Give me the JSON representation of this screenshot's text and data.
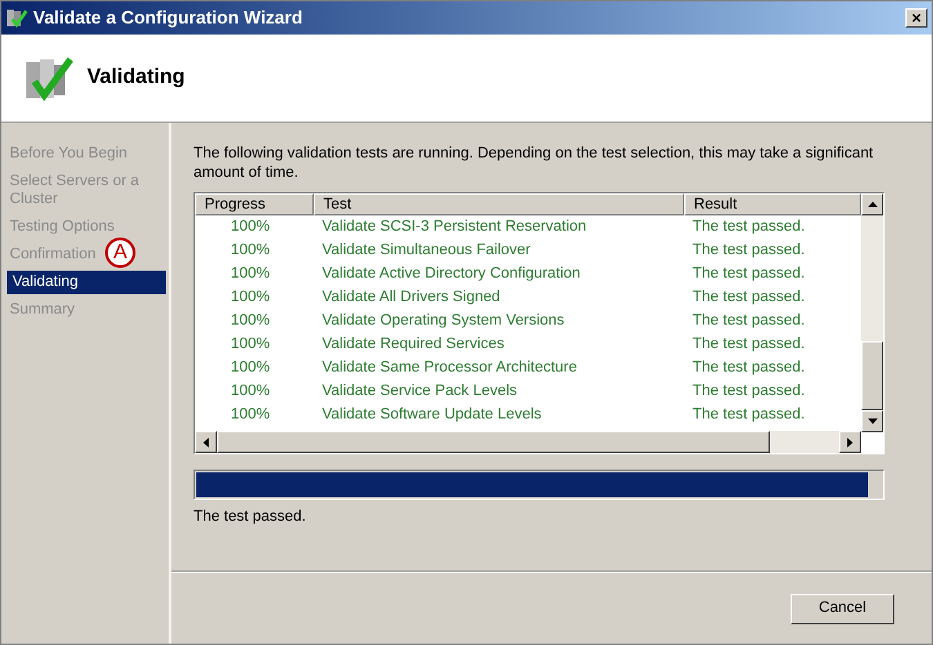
{
  "window": {
    "title": "Validate a Configuration Wizard",
    "close": "×"
  },
  "header": {
    "title": "Validating"
  },
  "steps": [
    {
      "label": "Before You Begin",
      "selected": false
    },
    {
      "label": "Select Servers or a Cluster",
      "selected": false
    },
    {
      "label": "Testing Options",
      "selected": false
    },
    {
      "label": "Confirmation",
      "selected": false,
      "callout": "A"
    },
    {
      "label": "Validating",
      "selected": true
    },
    {
      "label": "Summary",
      "selected": false
    }
  ],
  "intro": "The following validation tests are running. Depending on the test selection, this may take a significant amount of time.",
  "table": {
    "columns": [
      "Progress",
      "Test",
      "Result"
    ],
    "rows": [
      [
        "100%",
        "Validate SCSI-3 Persistent Reservation",
        "The test passed."
      ],
      [
        "100%",
        "Validate Simultaneous Failover",
        "The test passed."
      ],
      [
        "100%",
        "Validate Active Directory Configuration",
        "The test passed."
      ],
      [
        "100%",
        "Validate All Drivers Signed",
        "The test passed."
      ],
      [
        "100%",
        "Validate Operating System Versions",
        "The test passed."
      ],
      [
        "100%",
        "Validate Required Services",
        "The test passed."
      ],
      [
        "100%",
        "Validate Same Processor Architecture",
        "The test passed."
      ],
      [
        "100%",
        "Validate Service Pack Levels",
        "The test passed."
      ],
      [
        "100%",
        "Validate Software Update Levels",
        "The test passed."
      ]
    ]
  },
  "progress": {
    "level": 0.98
  },
  "status": "The test passed.",
  "buttons": [
    "Cancel"
  ]
}
